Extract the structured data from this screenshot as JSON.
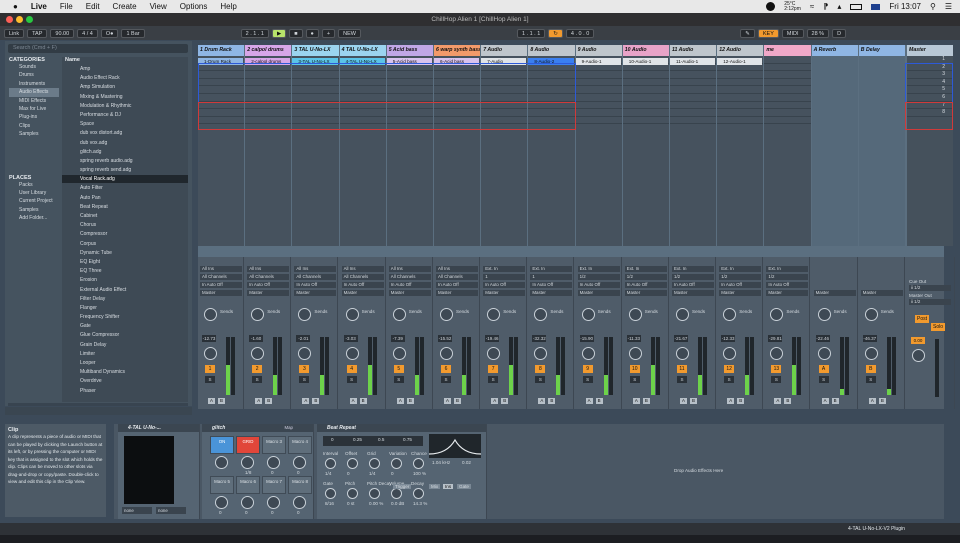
{
  "menubar": {
    "apple": "",
    "app": "Live",
    "items": [
      "File",
      "Edit",
      "Create",
      "View",
      "Options",
      "Help"
    ],
    "weather": "25°C",
    "weather_time": "2:12pm",
    "day_time": "Fri 13:07"
  },
  "window": {
    "title": "ChillHop Alien 1 [ChillHop Alien 1]"
  },
  "control_bar": {
    "link": "Link",
    "tap": "TAP",
    "tempo": "90.00",
    "signature": "4 / 4",
    "metronome": "O●",
    "quant": "1 Bar",
    "position": "2 . 1 . 1",
    "loop_pos": "1 . 1 . 1",
    "loop_len": "4 . 0 . 0",
    "new": "NEW",
    "key": "KEY",
    "midi": "MIDI",
    "cpu": "28 %",
    "d_label": "D"
  },
  "browser": {
    "search_placeholder": "Search (Cmd + F)",
    "categories_header": "CATEGORIES",
    "name_header": "Name",
    "categories": [
      "Sounds",
      "Drums",
      "Instruments",
      "Audio Effects",
      "MIDI Effects",
      "Max for Live",
      "Plug-ins",
      "Clips",
      "Samples"
    ],
    "places_header": "PLACES",
    "places": [
      "Packs",
      "User Library",
      "Current Project",
      "Samples",
      "Add Folder..."
    ],
    "files": [
      "Amp",
      "Audio Effect Rack",
      "Amp Simulation",
      "Mixing & Mastering",
      "Modulation & Rhythmic",
      "Performance & DJ",
      "Space",
      "dub vox distort.adg",
      "dub vox.adg",
      "glitch.adg",
      "spring reverb audio.adg",
      "spring reverb send.adg",
      "Vocal Rack.adg",
      "Auto Filter",
      "Auto Pan",
      "Beat Repeat",
      "Cabinet",
      "Chorus",
      "Compressor",
      "Corpus",
      "Dynamic Tube",
      "EQ Eight",
      "EQ Three",
      "Erosion",
      "External Audio Effect",
      "Filter Delay",
      "Flanger",
      "Frequency Shifter",
      "Gate",
      "Glue Compressor",
      "Grain Delay",
      "Limiter",
      "Looper",
      "Multiband Dynamics",
      "Overdrive",
      "Phaser"
    ]
  },
  "tracks": [
    {
      "name": "1 Drum Rack",
      "color": "#8fb6e4",
      "clip": "1-Drum Rack",
      "clip_color": "#8fb6e4",
      "vol": "-12.73",
      "num": "1",
      "input": "All Ins",
      "channel": "All Channels",
      "pan": "C"
    },
    {
      "name": "2 calpol drums",
      "color": "#d7a6e8",
      "clip": "2-calpol drums",
      "clip_color": "#d7a6e8",
      "vol": "-1.60",
      "num": "2",
      "input": "All Ins",
      "channel": "All Channels",
      "pan": "C"
    },
    {
      "name": "3 TAL U-No-LX",
      "color": "#9bd4ef",
      "clip": "3-TAL U-No-LX",
      "clip_color": "#5bc4e8",
      "vol": "-2.01",
      "num": "3",
      "input": "All Ins",
      "channel": "All Channels",
      "pan": "C"
    },
    {
      "name": "4 TAL U-No-LX",
      "color": "#9bd4ef",
      "clip": "4-TAL U-No-LX",
      "clip_color": "#5bc4e8",
      "vol": "-3.03",
      "num": "4",
      "input": "All Ins",
      "channel": "All Channels",
      "pan": "C"
    },
    {
      "name": "5 Acid bass",
      "color": "#c0a7e6",
      "clip": "5-Acid bass",
      "clip_color": "#d8c3ef",
      "vol": "-7.39",
      "num": "5",
      "input": "All Ins",
      "channel": "All Channels",
      "pan": "C"
    },
    {
      "name": "6 warp synth bass",
      "color": "#f29a6a",
      "clip": "6-Acid bass",
      "clip_color": "#d8c3ef",
      "vol": "-15.52",
      "num": "6",
      "input": "All Ins",
      "channel": "All Channels",
      "pan": "C"
    },
    {
      "name": "7 Audio",
      "color": "#bfc6cc",
      "clip": "7-Audio",
      "clip_color": "#e0e4e8",
      "vol": "-19.46",
      "num": "7",
      "input": "Ext. In",
      "channel": "1",
      "pan": "C"
    },
    {
      "name": "8 Audio",
      "color": "#bfc6cc",
      "clip": "8-Audio-2",
      "clip_color": "#3a7ff0",
      "vol": "-32.32",
      "num": "8",
      "input": "Ext. In",
      "channel": "1",
      "pan": "C"
    },
    {
      "name": "9 Audio",
      "color": "#bfc6cc",
      "clip": "9-Audio-1",
      "clip_color": "#e0e4e8",
      "vol": "-15.90",
      "num": "9",
      "input": "Ext. In",
      "channel": "1/2",
      "pan": "C"
    },
    {
      "name": "10 Audio",
      "color": "#e8a3c8",
      "clip": "10-Audio-1",
      "clip_color": "#e0e4e8",
      "vol": "-11.33",
      "num": "10",
      "input": "Ext. In",
      "channel": "1/2",
      "pan": "C"
    },
    {
      "name": "11 Audio",
      "color": "#bfc6cc",
      "clip": "11-Audio-1",
      "clip_color": "#e0e4e8",
      "vol": "-21.67",
      "num": "11",
      "input": "Ext. In",
      "channel": "1/2",
      "pan": "C"
    },
    {
      "name": "12 Audio",
      "color": "#bfc6cc",
      "clip": "12-Audio-1",
      "clip_color": "#e0e4e8",
      "vol": "-12.33",
      "num": "12",
      "input": "Ext. In",
      "channel": "1/2",
      "pan": "C"
    },
    {
      "name": "me",
      "color": "#f0a8c8",
      "clip": "",
      "clip_color": "#4a5662",
      "vol": "-29.81",
      "num": "13",
      "input": "Ext. In",
      "channel": "1/2",
      "pan": "C"
    }
  ],
  "returns": [
    {
      "name": "A Reverb",
      "vol": "-22.46",
      "letter": "A"
    },
    {
      "name": "B Delay",
      "vol": "-46.37",
      "letter": "B"
    }
  ],
  "master": {
    "name": "Master",
    "scenes": [
      "1",
      "2",
      "3",
      "4",
      "5",
      "6",
      "7",
      "8"
    ],
    "cue_out": "Cue Out",
    "cue_val": "ii 1/2",
    "master_out": "Master Out",
    "master_val": "ii 1/2",
    "vol": "0.00",
    "post": "Post",
    "solo": "Solo"
  },
  "routing_master_label": "Master",
  "sends_label": "Sends",
  "info": {
    "title": "Clip",
    "text": "A clip represents a piece of audio or MIDI that can be played by clicking the Launch button at its left, or by pressing the computer or MIDI key that is assigned to the slot which holds the clip. Clips can be moved to other slots via drag-and-drop or copy/paste. Double-click to view and edit this clip in the Clip View."
  },
  "devices": {
    "instrument": "4-TAL U-No-...",
    "inst_in": "none",
    "inst_out": "none",
    "rack": "glitch",
    "rack_map": "Map",
    "macros": [
      "ON",
      "GRID",
      "Macro 3",
      "Macro 4",
      "Macro 5",
      "Macro 6",
      "Macro 7",
      "Macro 8"
    ],
    "macro_vals": [
      "",
      "1/8",
      "0",
      "0",
      "0",
      "0",
      "0",
      "0"
    ],
    "beat": "Beat Repeat",
    "beat_ruler": [
      "0",
      "0.25",
      "0.5",
      "0.75"
    ],
    "params": [
      "Interval",
      "Offset",
      "Grid",
      "Variation",
      "Chance",
      "Gate",
      "Pitch",
      "Pitch Decay",
      "Volume",
      "Decay"
    ],
    "vals": [
      "1/4",
      "0",
      "1/4",
      "0",
      "100 %",
      "8/16",
      "0 st",
      "0.00 %",
      "0.0 dB",
      "14.3 %"
    ],
    "filter_freq": "1.04 kHz",
    "filter_q": "0.02",
    "trigger": "Trigger",
    "mix": "Mix",
    "ins": "Ins",
    "gate_btn": "Gate",
    "drop": "Drop Audio Effects Here"
  },
  "status": {
    "device": "4-TAL U-No-LX-V2 Plugin"
  }
}
